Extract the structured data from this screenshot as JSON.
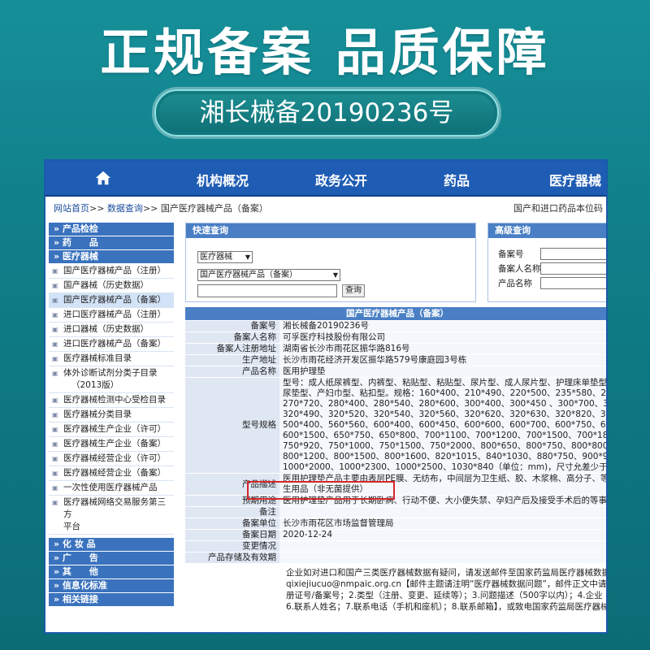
{
  "banner": {
    "title": "正规备案  品质保障",
    "record": "湘长械备20190236号"
  },
  "colors": {
    "teal": "#168f99",
    "nav_blue": "#1f5db4",
    "highlight_red": "#d7262b"
  },
  "topnav": {
    "home_icon": "home-icon",
    "items": [
      "机构概况",
      "政务公开",
      "药品",
      "医疗器械"
    ]
  },
  "breadcrumb": {
    "home": "网站首页",
    "sep1": ">>",
    "query": "数据查询",
    "sep2": ">>",
    "current": "国产医疗器械产品（备案）",
    "right": "国产和进口药品本位码"
  },
  "sidebar": {
    "sections": [
      {
        "label": "» 产品检检"
      },
      {
        "label": "» 药　　品"
      },
      {
        "label": "» 医疗器械"
      }
    ],
    "items": [
      "国产医疗器械产品（注册）",
      "国产器械（历史数据）",
      "国产医疗器械产品（备案）",
      "进口医疗器械产品（注册）",
      "进口器械（历史数据）",
      "进口医疗器械产品（备案）",
      "医疗器械标准目录",
      "体外诊断试剂分类子目录",
      "（2013版）",
      "医疗器械检测中心受检目录",
      "医疗器械分类目录",
      "医疗器械生产企业（许可）",
      "医疗器械生产企业（备案）",
      "医疗器械经营企业（许可）",
      "医疗器械经营企业（备案）",
      "一次性使用医疗器械产品",
      "医疗器械网络交易服务第三方",
      "平台"
    ],
    "bottom_sections": [
      "» 化 妆 品",
      "» 广　　告",
      "» 其　　他",
      "» 信息化标准",
      "» 相关链接"
    ]
  },
  "quick_search": {
    "title": "快速查询",
    "select1": "医疗器械",
    "select2": "国产医疗器械产品（备案）",
    "button": "查询"
  },
  "advanced_search": {
    "title": "高级查询",
    "fields": [
      "备案号",
      "备案人名称",
      "产品名称"
    ]
  },
  "table": {
    "title": "国产医疗器械产品（备案）",
    "rows": [
      {
        "label": "备案号",
        "value": [
          "湘长械备20190236号"
        ]
      },
      {
        "label": "备案人名称",
        "value": [
          "可孚医疗科技股份有限公司"
        ]
      },
      {
        "label": "备案人注册地址",
        "value": [
          "湖南省长沙市雨花区振华路816号"
        ]
      },
      {
        "label": "生产地址",
        "value": [
          "长沙市雨花经济开发区振华路579号康庭园3号栋"
        ]
      },
      {
        "label": "产品名称",
        "value": [
          "医用护理垫"
        ]
      },
      {
        "label": "型号规格",
        "value": [
          "型号：成人纸尿裤型、内裤型、粘贴型、粘贴型、尿片型、成人尿片型、护理床单垫型",
          "尿垫型、产妇巾型、粘扣型。规格：160*400、210*490、220*500、235*580、240*",
          "270*720、280*400、280*540、280*600、300*400、300*450 、300*700、300*7",
          "320*490、320*520、320*540、320*560、320*620、320*630、320*820、330*2",
          "500*400、560*560、600*400、600*450、600*600、600*700、600*750、600*80",
          "600*1500、650*750、650*800、700*1100、700*1200、700*1500、700*1800、",
          "750*920、750*1000、750*1500、750*2000、800*650、800*750、800*800、80",
          "800*1200、800*1500、800*1600、820*1015、840*1030、880*750、900*900、9",
          "1000*2000、1000*2300、1000*2500、1030*840（单位：mm)，尺寸允差少于+10"
        ]
      },
      {
        "label": "产品描述",
        "value": [
          "医用护理垫产品主要由表层PE膜、无纺布，中间层为卫生纸、胶、木浆棉、高分子、等",
          "生用品（非无菌提供）"
        ]
      },
      {
        "label": "预期用途",
        "value": [
          "医用护理垫产品用于长期卧病、行动不便、大小便失禁、孕妇产后及接受手术后的等事"
        ]
      },
      {
        "label": "备注",
        "value": [
          ""
        ]
      },
      {
        "label": "备案单位",
        "value": [
          "长沙市雨花区市场监督管理局"
        ]
      },
      {
        "label": "备案日期",
        "value": [
          "2020-12-24"
        ]
      },
      {
        "label": "变更情况",
        "value": [
          ""
        ]
      },
      {
        "label": "产品存储及有效期",
        "value": [
          ""
        ]
      }
    ],
    "notice": [
      "企业如对进口和国产三类医疗器械数据有疑问，请发送邮件至国家药监局医疗器械数据",
      "qixiejiucuo@nmpaic.org.cn【邮件主题请注明“医疗器械数据问题”，邮件正文中请",
      "册证号/备案号；2.类型（注册、变更、延续等）；3.问题描述（500字以内）；4.企业",
      "6.联系人姓名；7.联系电话（手机和座机）；8.联系邮箱】，或致电国家药监局医疗器械"
    ]
  }
}
